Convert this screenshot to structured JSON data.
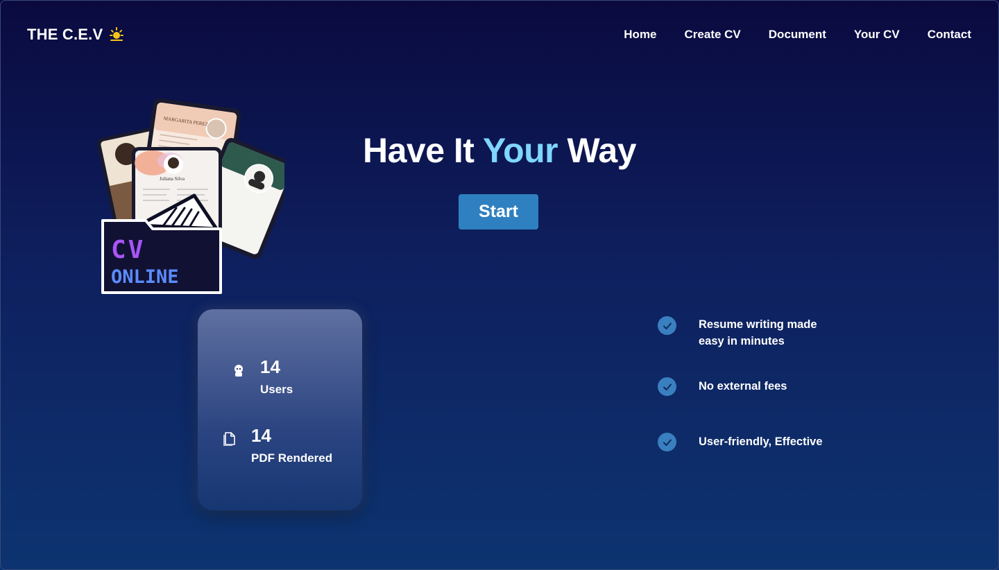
{
  "brand": {
    "name": "THE C.E.V"
  },
  "nav": {
    "items": [
      {
        "label": "Home"
      },
      {
        "label": "Create CV"
      },
      {
        "label": "Document"
      },
      {
        "label": "Your CV"
      },
      {
        "label": "Contact"
      }
    ]
  },
  "hero": {
    "headline_part1": "Have It",
    "headline_accent": "Your",
    "headline_part2": "Way",
    "start_label": "Start"
  },
  "illustration": {
    "folder_line1": "CV",
    "folder_line2": "ONLINE",
    "resume_names": [
      "MARGARITA PEREZ",
      "Juliana Silva"
    ]
  },
  "stats": [
    {
      "value": "14",
      "label": "Users",
      "icon": "user-icon"
    },
    {
      "value": "14",
      "label": "PDF Rendered",
      "icon": "document-icon"
    }
  ],
  "features": [
    {
      "text": "Resume writing made easy in minutes",
      "icon": "check-circle-icon"
    },
    {
      "text": "No external fees",
      "icon": "check-circle-icon"
    },
    {
      "text": "User-friendly, Effective",
      "icon": "check-circle-icon"
    }
  ],
  "colors": {
    "accent": "#7fd6ff",
    "button": "#2f80c0",
    "check": "#3a7fc0",
    "bg_top": "#0a0a3f",
    "bg_bottom": "#0d3470"
  }
}
